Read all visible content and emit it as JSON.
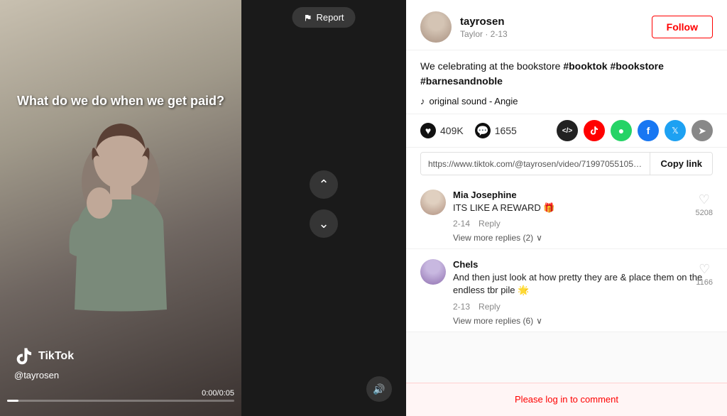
{
  "video": {
    "text": "What do we do when we get paid?",
    "brand": "TikTok",
    "username": "@tayrosen",
    "timer": "0:00/0:05"
  },
  "report_btn": "Report",
  "post": {
    "username": "tayrosen",
    "meta": "Taylor · 2-13",
    "follow_label": "Follow",
    "caption": "We celebrating at the bookstore #booktok #bookstore #barnesandnoble",
    "sound": "original sound - Angie",
    "likes": "409K",
    "comments": "1655",
    "link": "https://www.tiktok.com/@tayrosen/video/71997055105375...",
    "copy_link": "Copy link"
  },
  "share_icons": {
    "code": "</>",
    "red": "▽",
    "green": "●",
    "blue_f": "f",
    "blue_t": "t",
    "arrow": "↗"
  },
  "comments": [
    {
      "username": "Mia Josephine",
      "text": "ITS LIKE A REWARD 🎁",
      "date": "2-14",
      "reply": "Reply",
      "likes": "5208",
      "view_replies": "View more replies (2)"
    },
    {
      "username": "Chels",
      "text": "And then just look at how pretty they are & place them on the endless tbr pile 🌟",
      "date": "2-13",
      "reply": "Reply",
      "likes": "1166",
      "view_replies": "View more replies (6)"
    }
  ],
  "login_prompt": "Please log in to comment"
}
